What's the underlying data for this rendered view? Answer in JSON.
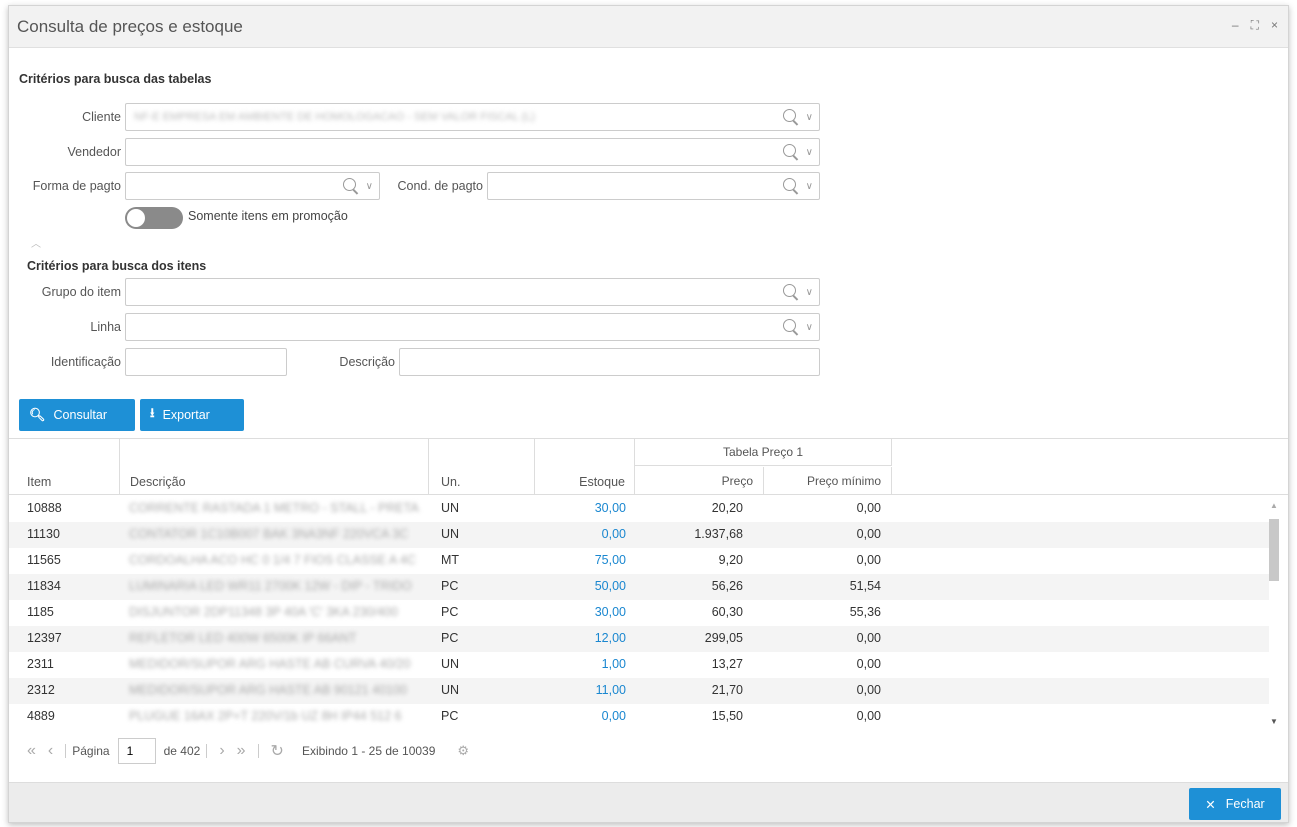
{
  "window": {
    "title": "Consulta de preços e estoque",
    "controls": {
      "minimize": "–",
      "maximize": "⛶",
      "close": "×"
    }
  },
  "tables_criteria": {
    "title": "Critérios para busca das tabelas",
    "cliente_label": "Cliente",
    "cliente_value": "NF-E EMPRESA EM AMBIENTE DE HOMOLOGACAO - SEM VALOR FISCAL (L)",
    "vendedor_label": "Vendedor",
    "vendedor_value": "",
    "forma_pagto_label": "Forma de pagto",
    "forma_pagto_value": "",
    "cond_pagto_label": "Cond. de pagto",
    "cond_pagto_value": "",
    "promo_toggle_label": "Somente itens em promoção",
    "promo_toggle_on": false
  },
  "items_criteria": {
    "title": "Critérios para busca dos itens",
    "grupo_label": "Grupo do item",
    "grupo_value": "",
    "linha_label": "Linha",
    "linha_value": "",
    "identificacao_label": "Identificação",
    "identificacao_value": "",
    "descricao_label": "Descrição",
    "descricao_value": ""
  },
  "actions": {
    "consultar_label": "Consultar",
    "exportar_label": "Exportar"
  },
  "grid": {
    "columns": {
      "item": "Item",
      "descricao": "Descrição",
      "un": "Un.",
      "estoque": "Estoque",
      "group": "Tabela Preço 1",
      "preco": "Preço",
      "preco_minimo": "Preço mínimo"
    },
    "rows": [
      {
        "item": "10888",
        "descricao": "CORRENTE RASTADA 1 METRO - STALL - PRETA",
        "un": "UN",
        "estoque": "30,00",
        "preco": "20,20",
        "preco_minimo": "0,00"
      },
      {
        "item": "11130",
        "descricao": "CONTATOR 1C10B007 BAK 3NA3NF 220VCA 3C",
        "un": "UN",
        "estoque": "0,00",
        "preco": "1.937,68",
        "preco_minimo": "0,00"
      },
      {
        "item": "11565",
        "descricao": "CORDOALHA ACO HC 0 1/4 7 FIOS CLASSE A 4C",
        "un": "MT",
        "estoque": "75,00",
        "preco": "9,20",
        "preco_minimo": "0,00"
      },
      {
        "item": "11834",
        "descricao": "LUMINARIA LED WR11 2700K 12W - DIP - TRIDO",
        "un": "PC",
        "estoque": "50,00",
        "preco": "56,26",
        "preco_minimo": "51,54"
      },
      {
        "item": "1185",
        "descricao": "DISJUNTOR 2DP11348 3P 40A 'C' 3KA 230/400",
        "un": "PC",
        "estoque": "30,00",
        "preco": "60,30",
        "preco_minimo": "55,36"
      },
      {
        "item": "12397",
        "descricao": "REFLETOR LED 400W 6500K IP 66ANT",
        "un": "PC",
        "estoque": "12,00",
        "preco": "299,05",
        "preco_minimo": "0,00"
      },
      {
        "item": "2311",
        "descricao": "MEDIDOR/SUPOR ARG HASTE AB CURVA 40/20",
        "un": "UN",
        "estoque": "1,00",
        "preco": "13,27",
        "preco_minimo": "0,00"
      },
      {
        "item": "2312",
        "descricao": "MEDIDOR/SUPOR ARG HASTE AB 90121 40100",
        "un": "UN",
        "estoque": "11,00",
        "preco": "21,70",
        "preco_minimo": "0,00"
      },
      {
        "item": "4889",
        "descricao": "PLUGUE 16AX 2P+T 220V/1b UZ 8H IP44 512 6",
        "un": "PC",
        "estoque": "0,00",
        "preco": "15,50",
        "preco_minimo": "0,00"
      }
    ]
  },
  "pager": {
    "page_label": "Página",
    "page_value": "1",
    "of_label": "de 402",
    "info": "Exibindo 1 - 25 de 10039"
  },
  "footer": {
    "close_label": "Fechar"
  }
}
